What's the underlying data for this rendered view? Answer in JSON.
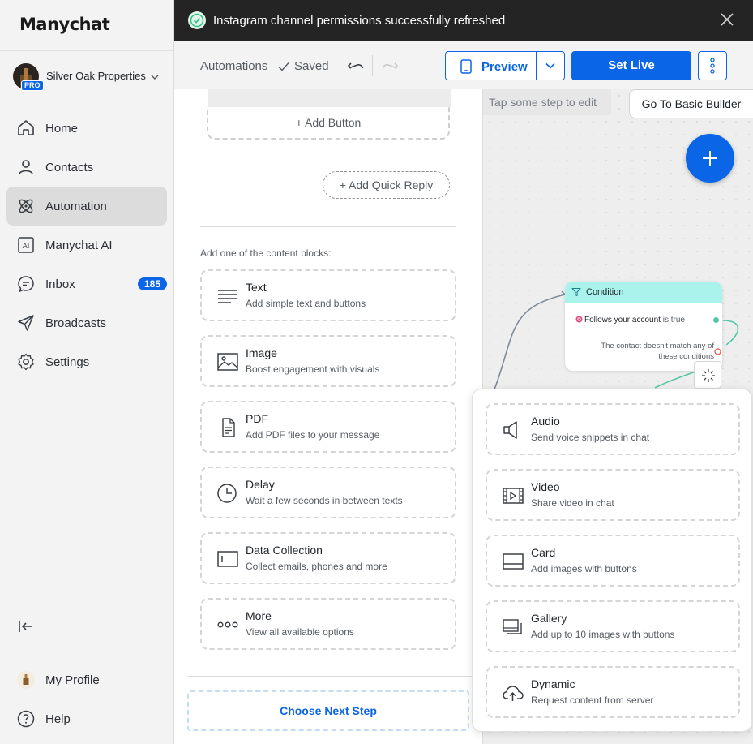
{
  "app": {
    "logo": "Manychat"
  },
  "account": {
    "name": "Silver Oak Properties",
    "badge": "PRO"
  },
  "sidebar": {
    "items": [
      {
        "label": "Home",
        "icon": "home-icon"
      },
      {
        "label": "Contacts",
        "icon": "user-icon"
      },
      {
        "label": "Automation",
        "icon": "atom-icon",
        "active": true
      },
      {
        "label": "Manychat AI",
        "icon": "ai-icon"
      },
      {
        "label": "Inbox",
        "icon": "chat-bubble-icon",
        "badge": "185"
      },
      {
        "label": "Broadcasts",
        "icon": "send-icon"
      },
      {
        "label": "Settings",
        "icon": "gear-icon"
      }
    ],
    "bottom": [
      {
        "label": "My Profile",
        "icon": "profile-avatar"
      },
      {
        "label": "Help",
        "icon": "help-icon"
      }
    ]
  },
  "toast": {
    "message": "Instagram channel permissions successfully refreshed"
  },
  "toolbar": {
    "breadcrumb": "Automations",
    "saved": "Saved",
    "preview": "Preview",
    "set_live": "Set Live"
  },
  "editor": {
    "add_button": "+ Add Button",
    "add_quick_reply": "+ Add Quick Reply",
    "blocks_title": "Add one of the content blocks:",
    "blocks": [
      {
        "title": "Text",
        "desc": "Add simple text and buttons",
        "icon": "text-lines-icon"
      },
      {
        "title": "Image",
        "desc": "Boost engagement with visuals",
        "icon": "image-icon"
      },
      {
        "title": "PDF",
        "desc": "Add PDF files to your message",
        "icon": "file-icon"
      },
      {
        "title": "Delay",
        "desc": "Wait a few seconds in between texts",
        "icon": "clock-icon"
      },
      {
        "title": "Data Collection",
        "desc": "Collect emails, phones and more",
        "icon": "input-field-icon"
      },
      {
        "title": "More",
        "desc": "View all available options",
        "icon": "dots-icon"
      }
    ],
    "choose_next_step": "Choose Next Step"
  },
  "canvas": {
    "hint": "Tap some step to edit",
    "basic_builder": "Go To Basic Builder",
    "condition": {
      "title": "Condition",
      "rule_subject": "Follows your account",
      "rule_suffix": " is true",
      "fallback": "The contact doesn't match any of these conditions"
    }
  },
  "popup": {
    "blocks": [
      {
        "title": "Audio",
        "desc": "Send voice snippets in chat",
        "icon": "speaker-icon"
      },
      {
        "title": "Video",
        "desc": "Share video in chat",
        "icon": "video-icon"
      },
      {
        "title": "Card",
        "desc": "Add images with buttons",
        "icon": "card-icon"
      },
      {
        "title": "Gallery",
        "desc": "Add up to 10 images with buttons",
        "icon": "gallery-icon"
      },
      {
        "title": "Dynamic",
        "desc": "Request content from server",
        "icon": "cloud-upload-icon"
      }
    ]
  },
  "colors": {
    "accent": "#0a66e6",
    "condition_header": "#a9f3ec",
    "toast_bg": "#242424",
    "success": "#3bbf8a"
  }
}
